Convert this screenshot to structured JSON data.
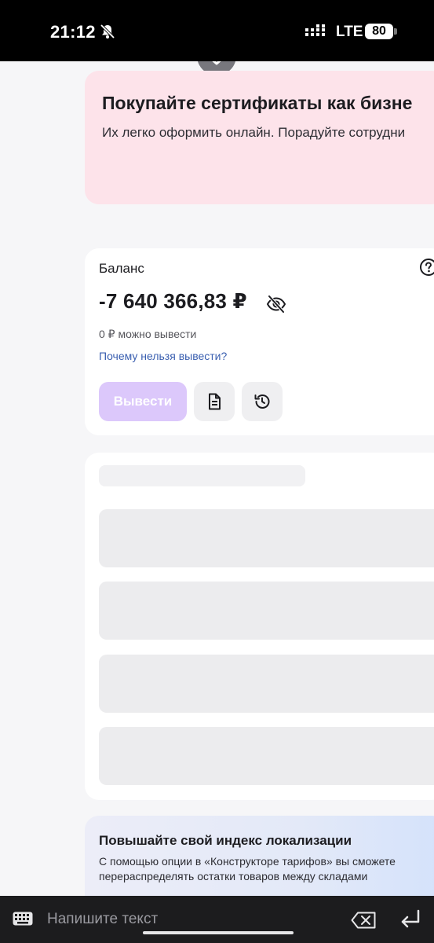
{
  "status_bar": {
    "time": "21:12",
    "network": "LTE",
    "battery": "80"
  },
  "promo": {
    "title": "Покупайте сертификаты как бизне",
    "text": "Их легко оформить онлайн. Порадуйте сотрудни"
  },
  "balance": {
    "label": "Баланс",
    "value": "-7 640 366,83 ₽",
    "withdrawable": "0 ₽ можно вывести",
    "why_link": "Почему нельзя вывести?",
    "withdraw_label": "Вывести"
  },
  "localization": {
    "title": "Повышайте свой индекс локализации",
    "text": "С помощью опции в «Конструкторе тарифов» вы сможете перераспределять остатки товаров между складами"
  },
  "input_bar": {
    "placeholder": "Напишите текст"
  },
  "colors": {
    "accent_disabled": "#dcc8fb",
    "promo_bg": "#fde3ea",
    "link": "#3a5fb0"
  },
  "icons": {
    "mute": "bell-off-icon",
    "hide": "eye-off-icon",
    "document": "document-icon",
    "history": "history-icon",
    "help": "question-icon"
  }
}
